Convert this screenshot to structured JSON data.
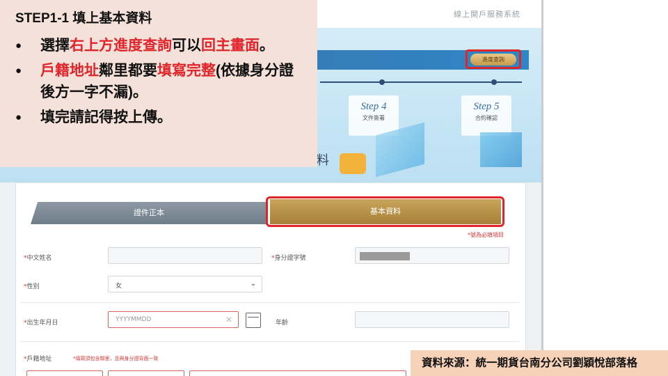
{
  "screenshot": {
    "system_title": "線上開戶服務系統",
    "progress_button": "進度查詢",
    "steps": [
      {
        "title": "Step 4",
        "subtitle": "文件簽署"
      },
      {
        "title": "Step 5",
        "subtitle": "合約確認"
      }
    ],
    "partial_heading": "料",
    "tabs": {
      "left": "證件正本",
      "right": "基本資料"
    },
    "required_note": "*號為必填項目",
    "fields": {
      "chinese_name_label": "中文姓名",
      "id_number_label": "身分證字號",
      "gender_label": "性別",
      "gender_value": "女",
      "birthdate_label": "出生年月日",
      "birthdate_placeholder": "YYYYMMDD",
      "age_label": "年齡",
      "household_address_label": "戶籍地址",
      "household_address_hint": "*填寫須包含鄰里，且與身分證背面一致"
    }
  },
  "note": {
    "title": "STEP1-1 填上基本資料",
    "bullet_glyph": "●",
    "items": [
      {
        "parts": [
          {
            "t": "選擇",
            "red": false
          },
          {
            "t": "右上方進度查詢",
            "red": true
          },
          {
            "t": "可以",
            "red": false
          },
          {
            "t": "回主畫面",
            "red": true
          },
          {
            "t": "。",
            "red": false
          }
        ]
      },
      {
        "parts": [
          {
            "t": "戶籍地址",
            "red": true
          },
          {
            "t": "鄰里都要",
            "red": false
          },
          {
            "t": "填寫完整",
            "red": true
          },
          {
            "t": "(依據身分證後方一字不漏)。",
            "red": false
          }
        ]
      },
      {
        "parts": [
          {
            "t": "填完請記得按上傳。",
            "red": false
          }
        ]
      }
    ]
  },
  "source_caption": "資料來源：統一期貨台南分公司劉穎悅部落格",
  "colors": {
    "highlight": "#e0242a",
    "note_bg": "#f4e1da",
    "caption_bg": "#f6d3b8",
    "tab_active": "#b58c40"
  }
}
